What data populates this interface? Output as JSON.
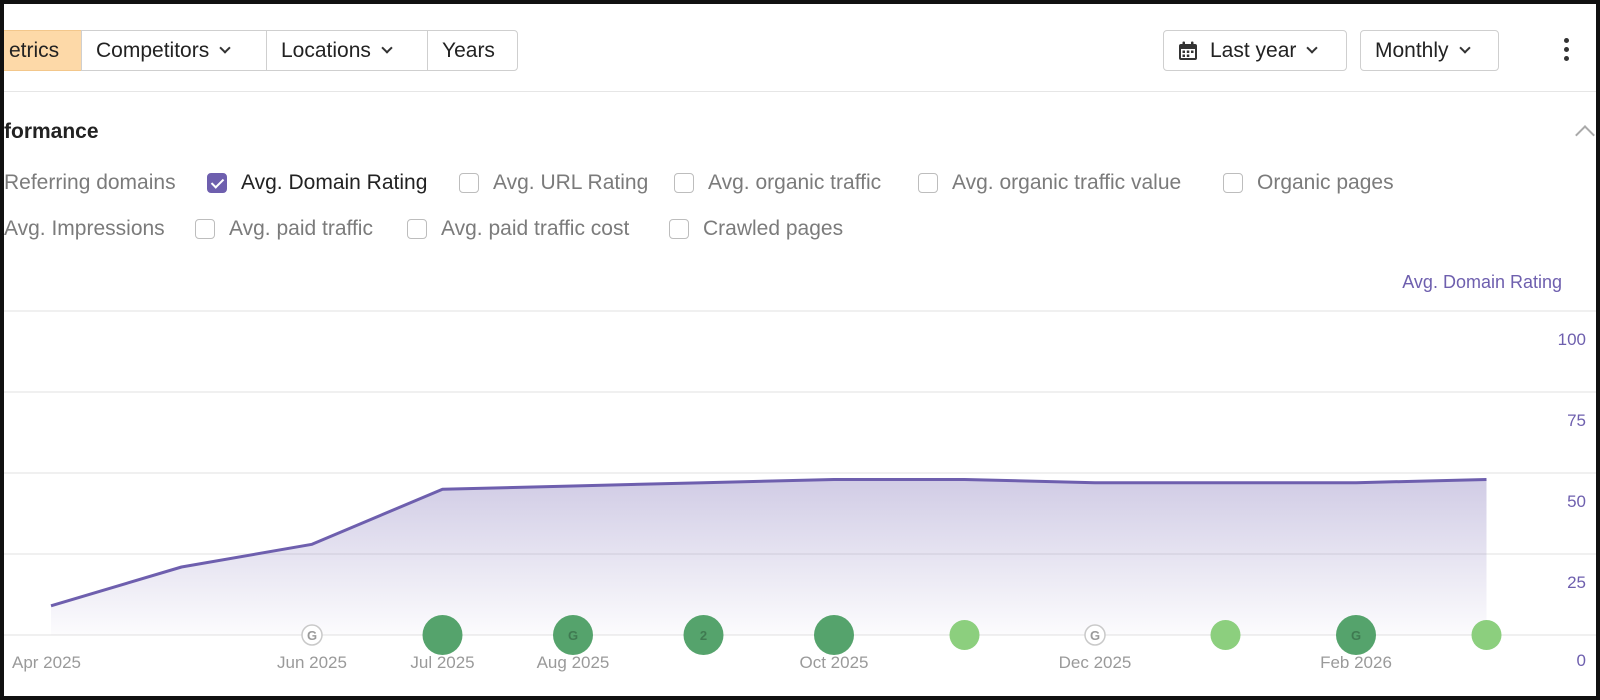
{
  "toolbar": {
    "tabs": [
      {
        "label": "etrics",
        "active": true
      },
      {
        "label": "Competitors",
        "dropdown": true
      },
      {
        "label": "Locations",
        "dropdown": true
      },
      {
        "label": "Years",
        "dropdown": false
      }
    ],
    "date_range": "Last year",
    "interval": "Monthly"
  },
  "section": {
    "title": "formance"
  },
  "metrics": [
    {
      "label": "Referring domains",
      "checked": false
    },
    {
      "label": "Avg. Domain Rating",
      "checked": true
    },
    {
      "label": "Avg. URL Rating",
      "checked": false
    },
    {
      "label": "Avg. organic traffic",
      "checked": false
    },
    {
      "label": "Avg. organic traffic value",
      "checked": false
    },
    {
      "label": "Organic pages",
      "checked": false
    },
    {
      "label": "Avg. Impressions",
      "checked": false
    },
    {
      "label": "Avg. paid traffic",
      "checked": false
    },
    {
      "label": "Avg. paid traffic cost",
      "checked": false
    },
    {
      "label": "Crawled pages",
      "checked": false
    }
  ],
  "colors": {
    "accent": "#6e5fae",
    "active_tab": "#fdd9a8",
    "marker_dark": "#55a36c",
    "marker_light": "#8ccf7e"
  },
  "chart_data": {
    "type": "area",
    "ylabel": "Avg. Domain Rating",
    "ylim": [
      0,
      100
    ],
    "yticks": [
      0,
      25,
      50,
      75,
      100
    ],
    "x_tick_labels": [
      "Apr 2025",
      "Jun 2025",
      "Jul 2025",
      "Aug 2025",
      "Oct 2025",
      "Dec 2025",
      "Feb 2026"
    ],
    "x": [
      "2025-04",
      "2025-05",
      "2025-06",
      "2025-07",
      "2025-08",
      "2025-09",
      "2025-10",
      "2025-11",
      "2025-12",
      "2026-01",
      "2026-02",
      "2026-03"
    ],
    "series": [
      {
        "values": [
          9,
          21,
          28,
          45,
          46,
          47,
          48,
          48,
          47,
          47,
          47,
          48
        ]
      }
    ],
    "markers": [
      {
        "x": "2025-06",
        "kind": "ring",
        "label": "G"
      },
      {
        "x": "2025-07",
        "kind": "large"
      },
      {
        "x": "2025-08",
        "kind": "large",
        "label": "G"
      },
      {
        "x": "2025-09",
        "kind": "large",
        "label": "2"
      },
      {
        "x": "2025-10",
        "kind": "large"
      },
      {
        "x": "2025-11",
        "kind": "small"
      },
      {
        "x": "2025-12",
        "kind": "ring",
        "label": "G"
      },
      {
        "x": "2026-01",
        "kind": "small"
      },
      {
        "x": "2026-02",
        "kind": "large",
        "label": "G"
      },
      {
        "x": "2026-03",
        "kind": "small"
      }
    ]
  }
}
